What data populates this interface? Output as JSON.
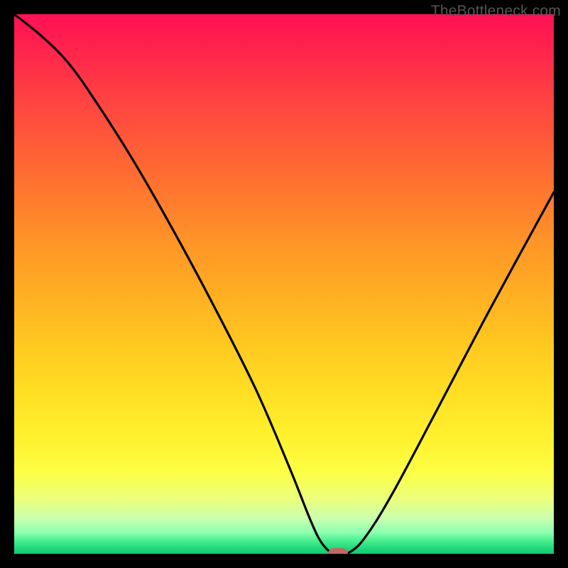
{
  "watermark": "TheBottleneck.com",
  "chart_data": {
    "type": "line",
    "title": "",
    "xlabel": "",
    "ylabel": "",
    "xlim": [
      0,
      100
    ],
    "ylim": [
      0,
      100
    ],
    "x": [
      0,
      5,
      10,
      15,
      22,
      30,
      38,
      45,
      51,
      55,
      57,
      59,
      60,
      62,
      65,
      70,
      78,
      88,
      100
    ],
    "values": [
      100,
      96,
      91,
      84,
      73,
      59,
      44,
      30,
      16,
      6,
      2,
      0,
      0,
      0.2,
      3,
      11,
      26,
      45,
      67
    ],
    "marker": {
      "x": 60,
      "y": 0
    },
    "gradient_stops": [
      {
        "pos": 0,
        "color": "#ff1155"
      },
      {
        "pos": 0.5,
        "color": "#ffc820"
      },
      {
        "pos": 0.85,
        "color": "#fcff45"
      },
      {
        "pos": 1.0,
        "color": "#16c770"
      }
    ]
  }
}
